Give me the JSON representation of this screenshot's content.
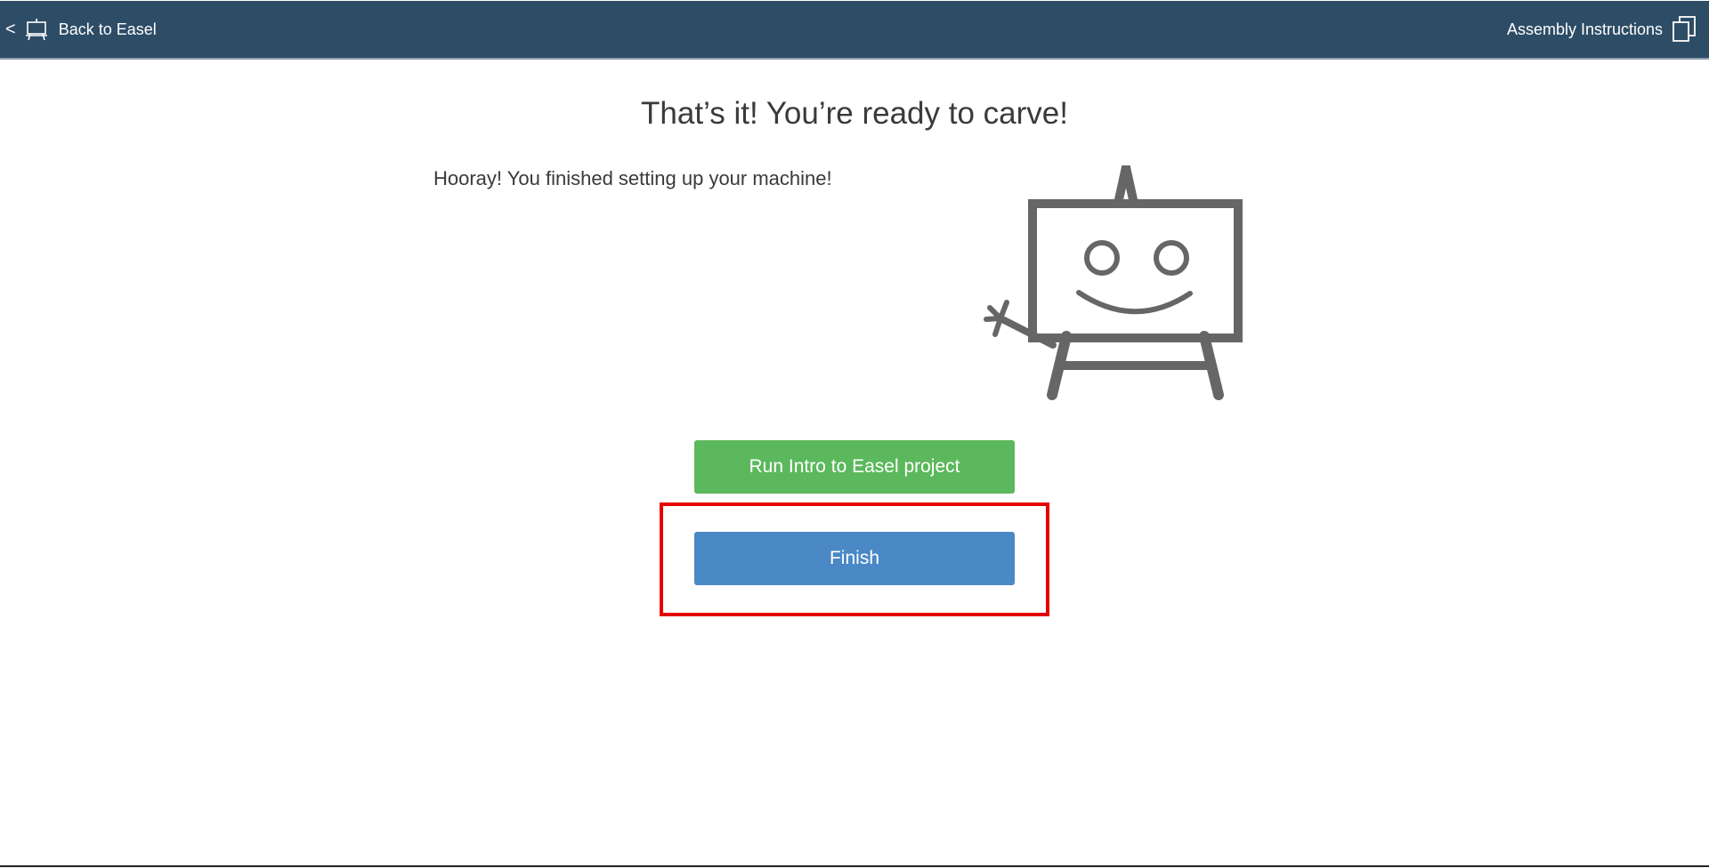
{
  "topbar": {
    "back_chevron": "<",
    "back_label": "Back to Easel",
    "assembly_label": "Assembly Instructions",
    "background_color": "#2d4c66"
  },
  "main": {
    "heading": "That’s it! You’re ready to carve!",
    "subtext": "Hooray! You finished setting up your machine!",
    "run_button_label": "Run Intro to Easel project",
    "finish_button_label": "Finish"
  },
  "icons": {
    "back": "easel-icon",
    "assembly": "copy-icon",
    "illustration": "easel-robot-waving"
  },
  "colors": {
    "run_button": "#5cb85c",
    "finish_button": "#4a88c6",
    "highlight": "#e60000",
    "illustration": "#666666"
  }
}
